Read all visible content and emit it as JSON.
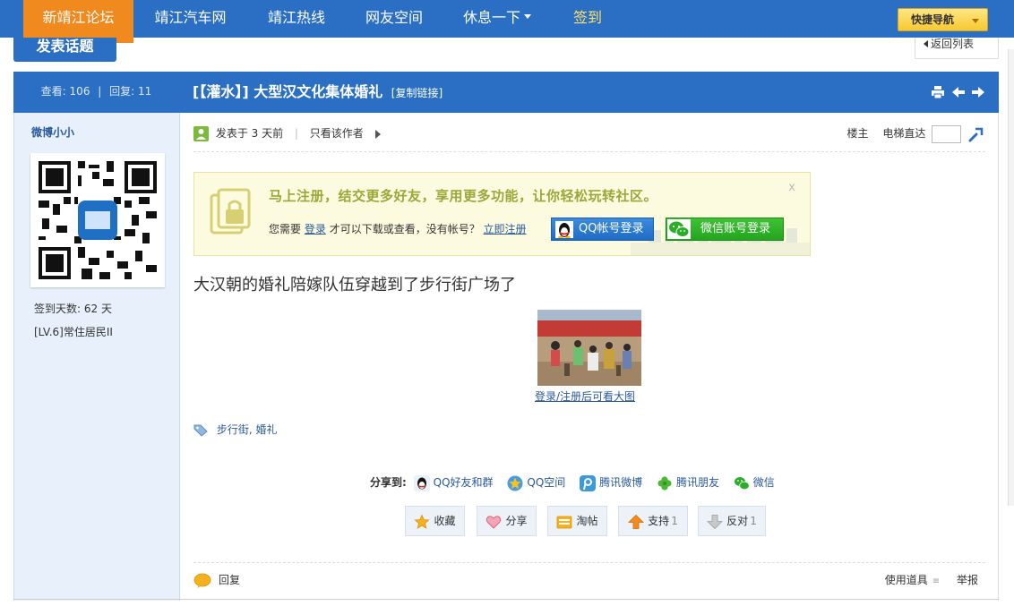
{
  "colors": {
    "nav_bg": "#2a6fc4",
    "nav_active": "#f08a1e",
    "checkin": "#ffe066",
    "link": "#2a5a9c",
    "login_headline": "#9aa83a"
  },
  "nav": {
    "items": [
      "新靖江论坛",
      "靖江汽车网",
      "靖江热线",
      "网友空间",
      "休息一下",
      "签到"
    ],
    "quick_nav": "快捷导航"
  },
  "toolbar": {
    "post_new": "发表话题",
    "back_list": "返回列表"
  },
  "thread": {
    "views_label": "查看:",
    "views": "106",
    "replies_label": "回复:",
    "replies": "11",
    "title": "[【灌水】] 大型汉文化集体婚礼",
    "copy_link": "[复制链接]"
  },
  "author": {
    "name": "微博小小",
    "checkin_days": "签到天数: 62 天",
    "level": "[LV.6]常住居民II"
  },
  "post": {
    "posted": "发表于 3 天前",
    "only_author": "只看该作者",
    "floor": "楼主",
    "jump_label": "电梯直达",
    "content": "大汉朝的婚礼陪嫁队伍穿越到了步行街广场了",
    "image_caption": "登录/注册后可看大图"
  },
  "login_prompt": {
    "headline": "马上注册，结交更多好友，享用更多功能，让你轻松玩转社区。",
    "desc_pre": "您需要",
    "login_link": "登录",
    "desc_mid": "才可以下载或查看，没有帐号？",
    "register_link": "立即注册",
    "qq_button": "QQ帐号登录",
    "wechat_button": "微信账号登录",
    "close": "x"
  },
  "tags": {
    "items": [
      "步行街",
      "婚礼"
    ],
    "separator": ","
  },
  "share": {
    "label": "分享到:",
    "targets": [
      "QQ好友和群",
      "QQ空间",
      "腾讯微博",
      "腾讯朋友",
      "微信"
    ]
  },
  "actions": {
    "favorite": "收藏",
    "share": "分享",
    "taotie": "淘帖",
    "support": "支持",
    "support_count": "1",
    "oppose": "反对",
    "oppose_count": "1"
  },
  "footer": {
    "reply": "回复",
    "use_tool": "使用道具",
    "report": "举报"
  }
}
